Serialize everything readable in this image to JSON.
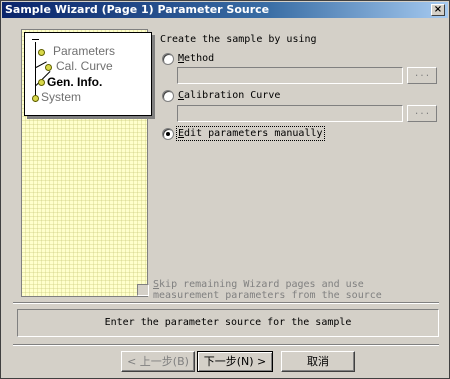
{
  "window": {
    "title": "Sample Wizard (Page 1) Parameter Source",
    "close_label": "×"
  },
  "nav": {
    "items": [
      {
        "label": "Parameters",
        "current": false
      },
      {
        "label": "Cal. Curve",
        "current": false
      },
      {
        "label": "Gen. Info.",
        "current": true
      },
      {
        "label": "System",
        "current": false
      }
    ]
  },
  "source": {
    "heading": "Create the sample by using",
    "options": [
      {
        "accel": "M",
        "rest": "ethod",
        "checked": false,
        "field_value": "",
        "browse_label": "..."
      },
      {
        "accel": "C",
        "rest": "alibration Curve",
        "checked": false,
        "field_value": "",
        "browse_label": "..."
      },
      {
        "accel": "E",
        "rest": "dit parameters manually",
        "checked": true
      }
    ]
  },
  "skip": {
    "accel": "S",
    "rest": "kip remaining Wizard pages and use measurement parameters from the source",
    "checked": false,
    "enabled": false
  },
  "status_text": "Enter the parameter source for the sample",
  "buttons": {
    "back": "< 上一步(B)",
    "next": "下一步(N) >",
    "cancel": "取消"
  },
  "colors": {
    "title_bar": "#0a246a",
    "dialog_bg": "#d4d0c8",
    "nav_panel": "#ffffcc",
    "nav_dot": "#d8d84a"
  }
}
